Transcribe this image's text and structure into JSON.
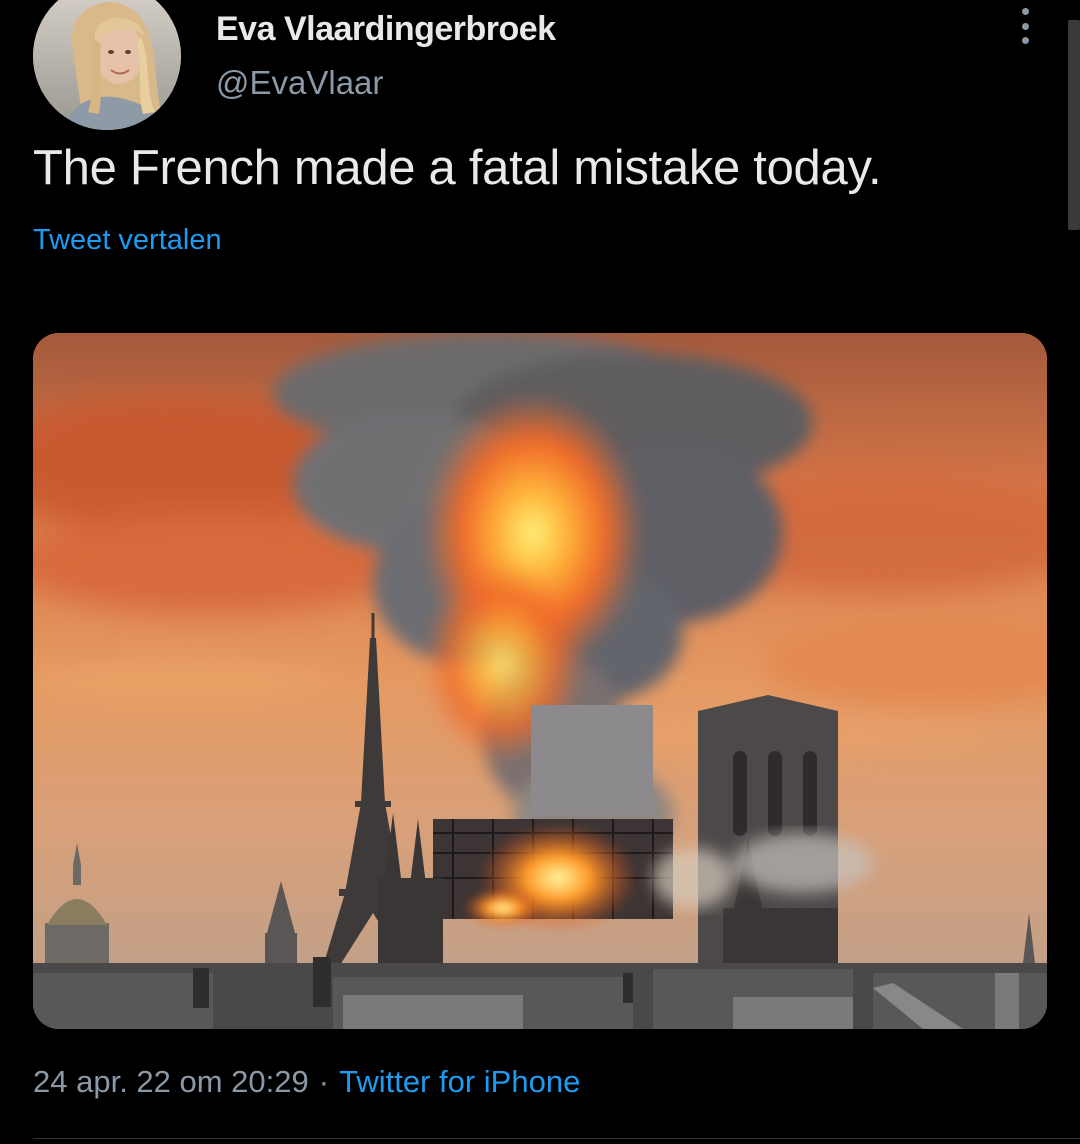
{
  "tweet": {
    "author": {
      "display_name": "Eva Vlaardingerbroek",
      "handle": "@EvaVlaar"
    },
    "text": "The French made a fatal mistake today.",
    "translate_label": "Tweet vertalen",
    "timestamp": "24 apr. 22 om 20:29",
    "separator": "·",
    "source": "Twitter for iPhone"
  },
  "icons": {
    "more": "more-vertical-icon"
  },
  "colors": {
    "background": "#000000",
    "text": "#e7e9ea",
    "secondary": "#8b98a5",
    "accent": "#1d9bf0"
  }
}
